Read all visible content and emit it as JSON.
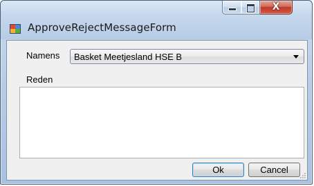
{
  "window": {
    "title": "ApproveRejectMessageForm",
    "icon": "winforms-app-icon",
    "controls": {
      "minimize_icon": "minimize-icon",
      "maximize_icon": "maximize-icon",
      "close_glyph": "X"
    }
  },
  "form": {
    "namens_label": "Namens",
    "namens_selected": "Basket Meetjesland HSE B",
    "reden_label": "Reden",
    "reden_value": ""
  },
  "buttons": {
    "ok_label": "Ok",
    "cancel_label": "Cancel"
  },
  "colors": {
    "close_button": "#c0392b",
    "client_background": "#f0f0f0",
    "default_button_border": "#3c7fb1"
  }
}
